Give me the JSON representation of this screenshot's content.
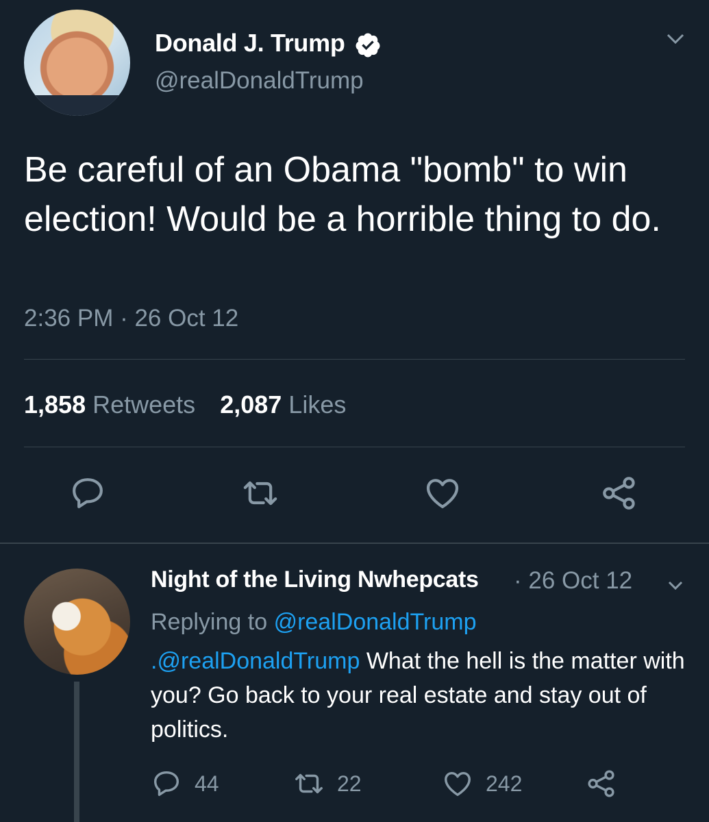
{
  "tweet": {
    "author_name": "Donald J. Trump",
    "author_handle": "@realDonaldTrump",
    "verified": true,
    "text": "Be careful of an Obama \"bomb\" to win election! Would be a horrible thing to do.",
    "timestamp": "2:36 PM · 26 Oct 12",
    "retweets_count": "1,858",
    "retweets_label": "Retweets",
    "likes_count": "2,087",
    "likes_label": "Likes",
    "actions": [
      "reply-icon",
      "retweet-icon",
      "like-icon",
      "share-icon"
    ]
  },
  "reply": {
    "author_name": "Night of the Living Nwhepcats",
    "date": "· 26 Oct 12",
    "replying_prefix": "Replying to",
    "replying_handle": "@realDonaldTrump",
    "mention": ".@realDonaldTrump",
    "text": " What the hell is the matter with you? Go back to your real estate and stay out of politics.",
    "reply_count": "44",
    "retweet_count": "22",
    "like_count": "242"
  },
  "colors": {
    "background": "#15202b",
    "secondary_text": "#8899a6",
    "link": "#1da1f2",
    "divider": "#38444d"
  }
}
